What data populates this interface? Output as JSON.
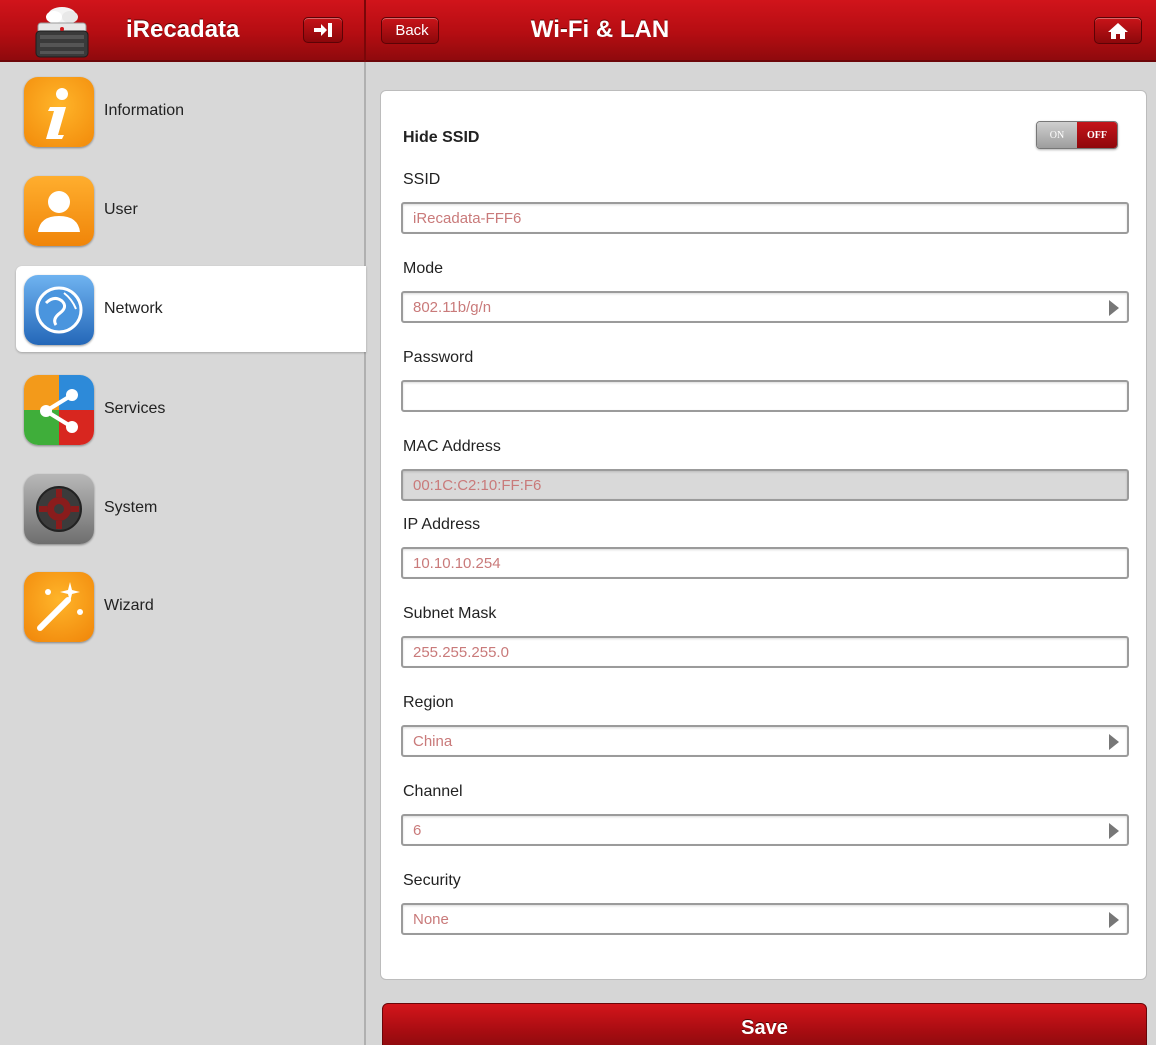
{
  "header": {
    "app_title": "iRecadata",
    "back_label": "Back",
    "page_title": "Wi-Fi & LAN"
  },
  "sidebar": {
    "items": [
      {
        "label": "Information",
        "icon": "information-icon"
      },
      {
        "label": "User",
        "icon": "user-icon"
      },
      {
        "label": "Network",
        "icon": "network-globe-icon",
        "active": true
      },
      {
        "label": "Services",
        "icon": "services-share-icon"
      },
      {
        "label": "System",
        "icon": "system-gear-icon"
      },
      {
        "label": "Wizard",
        "icon": "wizard-wand-icon"
      }
    ]
  },
  "form": {
    "hide_ssid": {
      "label": "Hide SSID",
      "on_label": "ON",
      "off_label": "OFF",
      "value": "OFF"
    },
    "ssid": {
      "label": "SSID",
      "value": "iRecadata-FFF6"
    },
    "mode": {
      "label": "Mode",
      "value": "802.11b/g/n"
    },
    "password": {
      "label": "Password",
      "value": ""
    },
    "mac": {
      "label": "MAC Address",
      "value": "00:1C:C2:10:FF:F6"
    },
    "ip": {
      "label": "IP Address",
      "value": "10.10.10.254"
    },
    "subnet": {
      "label": "Subnet Mask",
      "value": "255.255.255.0"
    },
    "region": {
      "label": "Region",
      "value": "China"
    },
    "channel": {
      "label": "Channel",
      "value": "6"
    },
    "security": {
      "label": "Security",
      "value": "None"
    }
  },
  "save_label": "Save",
  "colors": {
    "accent": "#b50d12",
    "field_text": "#c97a7a"
  }
}
